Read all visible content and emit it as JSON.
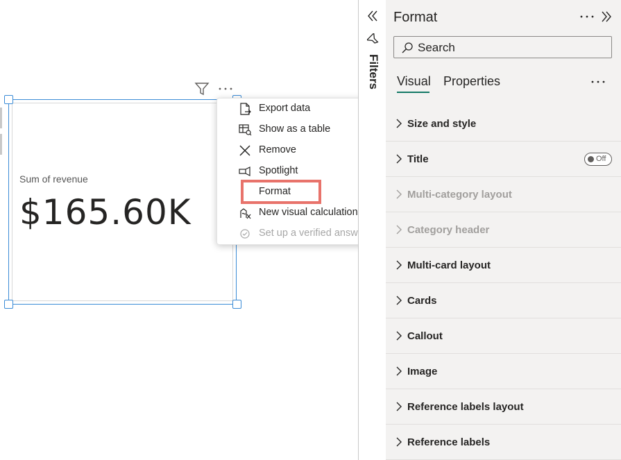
{
  "card": {
    "label": "Sum of revenue",
    "value": "$165.60K"
  },
  "visual_header": {
    "filter_icon": "filter-icon",
    "more_icon": "more-options-icon"
  },
  "context_menu": {
    "items": [
      {
        "label": "Export data",
        "icon": "export-data-icon"
      },
      {
        "label": "Show as a table",
        "icon": "show-as-table-icon"
      },
      {
        "label": "Remove",
        "icon": "remove-icon"
      },
      {
        "label": "Spotlight",
        "icon": "spotlight-icon"
      },
      {
        "label": "Format",
        "icon": ""
      },
      {
        "label": "New visual calculation",
        "icon": "visual-calculation-icon"
      },
      {
        "label": "Set up a verified answer",
        "icon": "verified-answer-icon"
      }
    ],
    "highlighted_item": "Format",
    "highlight_color": "#e8736b"
  },
  "filters_pane": {
    "label": "Filters"
  },
  "format_pane": {
    "title": "Format",
    "search_placeholder": "Search",
    "tabs": [
      "Visual",
      "Properties"
    ],
    "active_tab": "Visual",
    "accent_color": "#117865",
    "sections": [
      {
        "label": "Size and style",
        "enabled": true
      },
      {
        "label": "Title",
        "enabled": true,
        "toggle": "Off"
      },
      {
        "label": "Multi-category layout",
        "enabled": false
      },
      {
        "label": "Category header",
        "enabled": false
      },
      {
        "label": "Multi-card layout",
        "enabled": true
      },
      {
        "label": "Cards",
        "enabled": true
      },
      {
        "label": "Callout",
        "enabled": true
      },
      {
        "label": "Image",
        "enabled": true
      },
      {
        "label": "Reference labels layout",
        "enabled": true
      },
      {
        "label": "Reference labels",
        "enabled": true
      }
    ]
  }
}
